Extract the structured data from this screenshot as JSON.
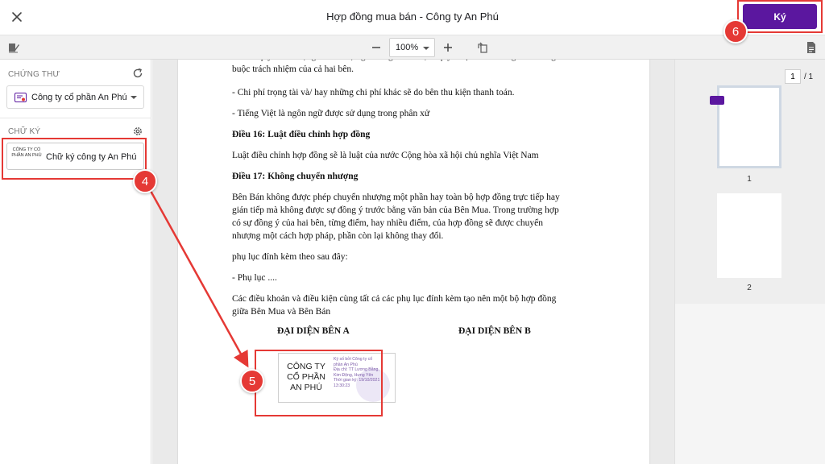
{
  "header": {
    "title": "Hợp đồng mua bán - Công ty An Phú",
    "sign_label": "Ký"
  },
  "toolbar": {
    "zoom": "100%"
  },
  "left_panel": {
    "cert_section_label": "CHỨNG THƯ",
    "cert_selected": "Công ty cổ phần An Phú",
    "signature_section_label": "CHỮ KÝ",
    "signature_item_label": "Chữ ký công ty An Phú",
    "signature_thumb_text": "CÔNG TY CỔ PHẦN AN PHÚ"
  },
  "document": {
    "lines": [
      {
        "text": "- Phán quyết của trọng tài sẽ được ghi bằng văn bản, là quyết định cuối cùng và sẽ ràng",
        "bold": false
      },
      {
        "text": "buộc trách nhiệm của cả hai bên.",
        "bold": false
      },
      {
        "text": "- Chi phí trọng tài và/ hay những chi phí khác sẽ do bên thu kiện thanh toán.",
        "bold": false
      },
      {
        "text": "- Tiếng Việt là ngôn ngữ được sử dụng trong phân xử",
        "bold": false
      },
      {
        "text": "Điều 16: Luật điều chỉnh hợp đồng",
        "bold": true
      },
      {
        "text": "Luật điều chỉnh hợp đồng sẽ là luật của nước Cộng hòa xã hội chủ nghĩa Việt Nam",
        "bold": false
      },
      {
        "text": "Điều 17: Không chuyển nhượng",
        "bold": true
      },
      {
        "text": "Bên Bán không được phép chuyển nhượng một phần hay toàn bộ hợp đồng trực tiếp hay",
        "bold": false
      },
      {
        "text": "gián tiếp mà không được sự đồng ý trước bằng văn bản của Bên Mua. Trong trường hợp",
        "bold": false
      },
      {
        "text": "có sự đồng ý của hai bên, từng điểm, hay nhiều điểm, của hợp đồng sẽ được chuyển",
        "bold": false
      },
      {
        "text": "nhượng một cách hợp pháp, phần còn lại không thay đổi.",
        "bold": false
      },
      {
        "text": "phụ lục đính kèm theo sau đây:",
        "bold": false
      },
      {
        "text": "- Phụ lục ....",
        "bold": false
      },
      {
        "text": "Các điều khoản và điều kiện cùng tất cả các phụ lục đính kèm tạo nên một bộ hợp đồng",
        "bold": false
      },
      {
        "text": "giữa Bên Mua và Bên Bán",
        "bold": false
      }
    ],
    "rep_a": "ĐẠI DIỆN BÊN A",
    "rep_b": "ĐẠI DIỆN BÊN B",
    "stamp": {
      "name": "CÔNG TY CỔ PHẦN AN PHÚ",
      "info_lines": [
        "Ký số bởi Công ty cổ",
        "phần An Phú",
        "Địa chỉ: TT Lương Bằng,",
        "Kim Động, Hưng Yên",
        "Thời gian ký: 19/10/2021",
        "13:30:23"
      ]
    }
  },
  "thumbnails": {
    "current_page": "1",
    "total": "/ 1",
    "pages": [
      "1",
      "2"
    ]
  },
  "annotations": [
    "4",
    "5",
    "6"
  ],
  "colors": {
    "accent": "#5b179f",
    "annotation": "#e53935"
  }
}
